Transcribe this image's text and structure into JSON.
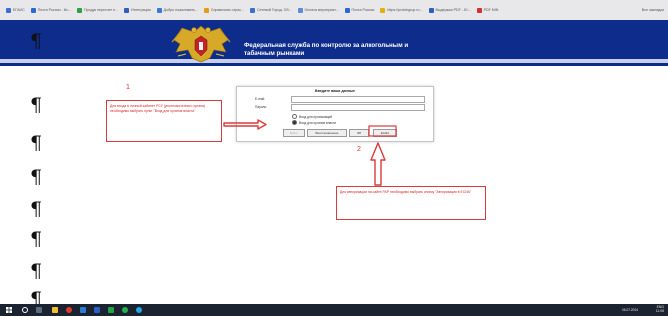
{
  "bookmarks": [
    {
      "label": "ЕГАИС",
      "color": "#3c6dd6"
    },
    {
      "label": "Почта России - Ис...",
      "color": "#2a68d8"
    },
    {
      "label": "Продук пересчет п...",
      "color": "#2ea043"
    },
    {
      "label": "Интеграция",
      "color": "#2f5fb8"
    },
    {
      "label": "Добро пожаловать...",
      "color": "#3a78d8"
    },
    {
      "label": "Справочник отрас...",
      "color": "#e79a16"
    },
    {
      "label": "Сетевой Город. Об...",
      "color": "#3a6fd0"
    },
    {
      "label": "Оплата мероприят...",
      "color": "#5f8ad8"
    },
    {
      "label": "Почта России",
      "color": "#2a68d8"
    },
    {
      "label": "https://protekgrup.ru...",
      "color": "#e0b010"
    },
    {
      "label": "Выдержки PDF - Ю...",
      "color": "#2f5fb8"
    },
    {
      "label": "PDF MIN",
      "color": "#d03030"
    }
  ],
  "bookmarks_other": "Все закладки",
  "header": {
    "title_line1": "Федеральная служба по контролю за алкогольным и",
    "title_line2": "табачным рынками",
    "bg_color": "#0e2c8c"
  },
  "pilcrow": "¶",
  "login": {
    "title": "Введите ваши данные",
    "email_label": "E-mail:",
    "password_label": "Пароль:",
    "radio_org": "Вход для организаций",
    "radio_gov": "Вход для органов власти",
    "radio_gov_selected": true,
    "buttons": {
      "login": "Войти",
      "recover": "Восстановление",
      "rkp": "ЭП",
      "esia": "ЕСИА"
    }
  },
  "annotations": {
    "num1": "1",
    "num2": "2",
    "callout1": "Для входа в личный кабинет РСУ (уполномоченного органа) необходимо выбрать пункт \"Вход для органов власти\"",
    "callout2": "Для авторизации на сайте РАР необходимо выбрать кнопку \"Авторизация в ЕСИА\"",
    "color": "#d93a3a"
  },
  "tray": {
    "time": "11:08",
    "date": "06.07.2024",
    "lang": "ENG"
  }
}
